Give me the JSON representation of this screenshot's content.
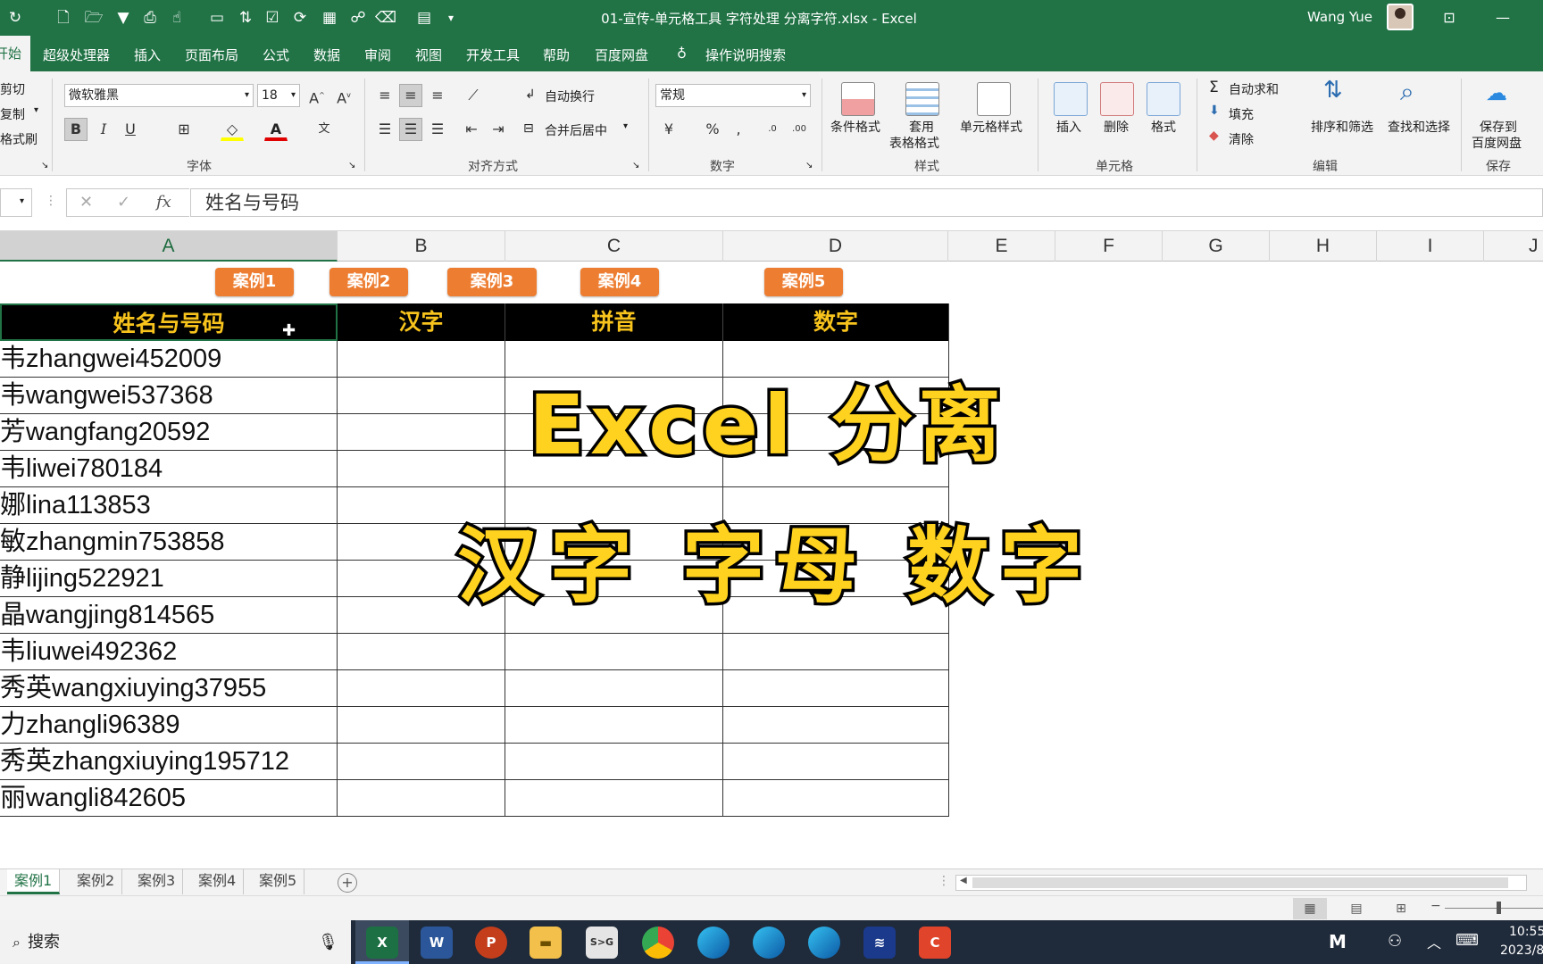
{
  "window": {
    "title": "01-宣传-单元格工具 字符处理 分离字符.xlsx  -  Excel",
    "user": "Wang Yue"
  },
  "menu": {
    "active_tab": "开始",
    "tabs": [
      "超级处理器",
      "插入",
      "页面布局",
      "公式",
      "数据",
      "审阅",
      "视图",
      "开发工具",
      "帮助",
      "百度网盘"
    ],
    "tell_me": "操作说明搜索"
  },
  "ribbon": {
    "clipboard": {
      "cut": "剪切",
      "copy": "复制",
      "format_painter": "格式刷"
    },
    "font": {
      "name": "微软雅黑",
      "size": "18",
      "group": "字体"
    },
    "alignment": {
      "wrap": "自动换行",
      "merge": "合并后居中",
      "group": "对齐方式"
    },
    "number": {
      "format": "常规",
      "group": "数字"
    },
    "styles": {
      "conditional": "条件格式",
      "table_line1": "套用",
      "table_line2": "表格格式",
      "cell_styles": "单元格样式",
      "group": "样式"
    },
    "cells": {
      "insert": "插入",
      "delete": "删除",
      "format": "格式",
      "group": "单元格"
    },
    "editing": {
      "autosum": "自动求和",
      "fill": "填充",
      "clear": "清除",
      "sort": "排序和筛选",
      "find": "查找和选择",
      "group": "编辑"
    },
    "save": {
      "line1": "保存到",
      "line2": "百度网盘",
      "group": "保存"
    }
  },
  "formula_bar": {
    "content": "姓名与号码"
  },
  "columns": [
    "A",
    "B",
    "C",
    "D",
    "E",
    "F",
    "G",
    "H",
    "I",
    "J"
  ],
  "buttons": [
    "案例1",
    "案例2",
    "案例3",
    "案例4",
    "案例5"
  ],
  "table": {
    "headers": [
      "姓名与号码",
      "汉字",
      "拼音",
      "数字"
    ],
    "rows": [
      "韦zhangwei452009",
      "韦wangwei537368",
      "芳wangfang20592",
      "韦liwei780184",
      "娜lina113853",
      "敏zhangmin753858",
      "静lijing522921",
      "晶wangjing814565",
      "韦liuwei492362",
      "秀英wangxiuying37955",
      "力zhangli96389",
      "秀英zhangxiuying195712",
      "丽wangli842605"
    ]
  },
  "overlay": {
    "line1": "Excel 分离",
    "line2": "汉字 字母 数字"
  },
  "sheet_tabs": [
    "案例1",
    "案例2",
    "案例3",
    "案例4",
    "案例5"
  ],
  "taskbar": {
    "search": "搜索",
    "time": "10:55",
    "date": "2023/8"
  },
  "colors": {
    "excel_green": "#217346",
    "tag_orange": "#ed7d31",
    "header_gold": "#f7c31c",
    "overlay_yellow": "#ffd21f"
  }
}
